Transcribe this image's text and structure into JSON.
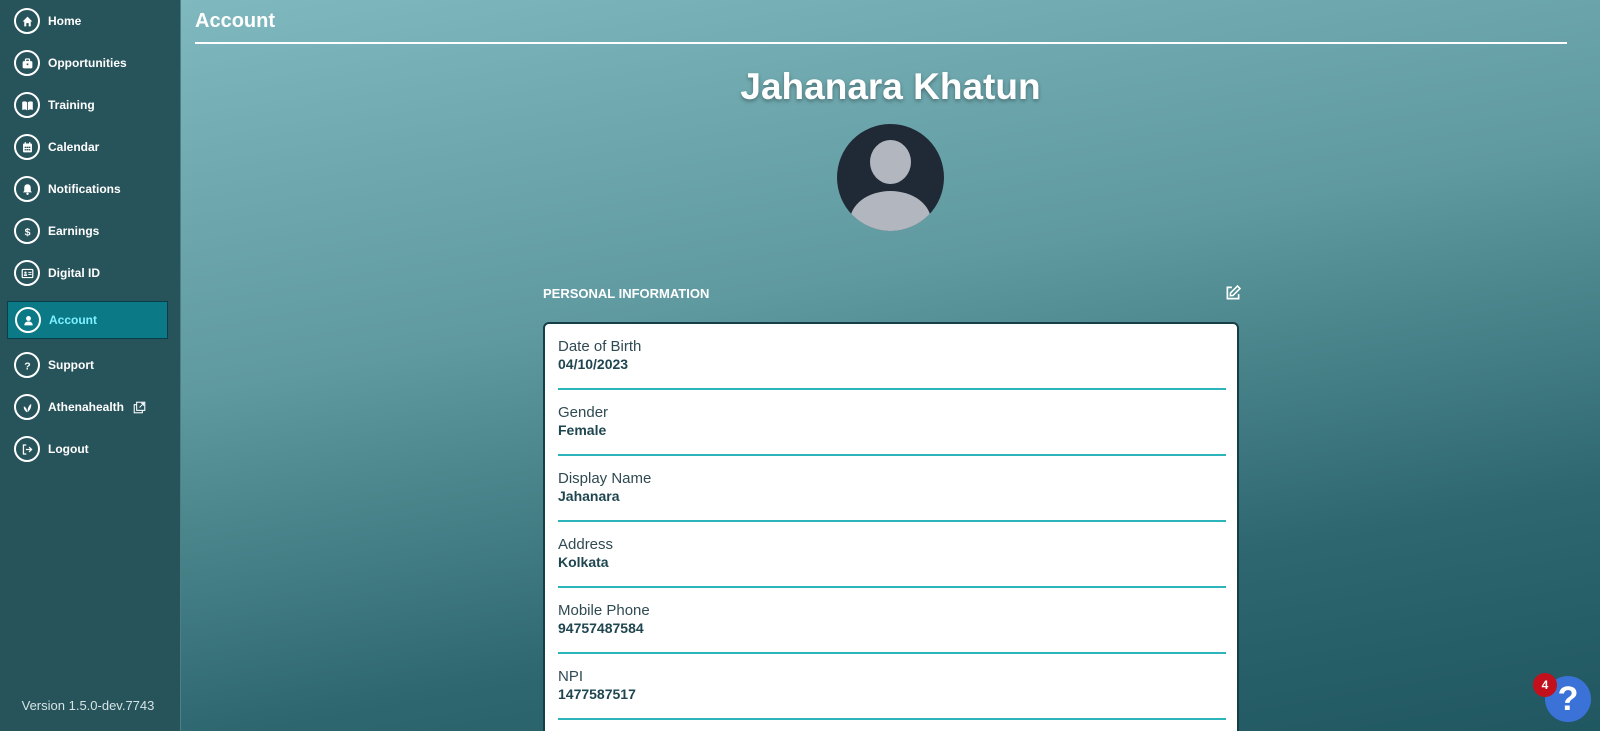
{
  "sidebar": {
    "items": [
      {
        "label": "Home",
        "icon": "home-icon"
      },
      {
        "label": "Opportunities",
        "icon": "briefcase-icon"
      },
      {
        "label": "Training",
        "icon": "book-icon"
      },
      {
        "label": "Calendar",
        "icon": "calendar-icon"
      },
      {
        "label": "Notifications",
        "icon": "bell-icon"
      },
      {
        "label": "Earnings",
        "icon": "dollar-icon"
      },
      {
        "label": "Digital ID",
        "icon": "id-card-icon"
      },
      {
        "label": "Account",
        "icon": "user-icon",
        "active": true
      },
      {
        "label": "Support",
        "icon": "question-icon"
      },
      {
        "label": "Athenahealth",
        "icon": "leaf-icon",
        "external": true
      },
      {
        "label": "Logout",
        "icon": "logout-icon"
      }
    ],
    "version": "Version 1.5.0-dev.7743"
  },
  "header": {
    "title": "Account"
  },
  "profile": {
    "name": "Jahanara Khatun"
  },
  "personal_info": {
    "section_title": "PERSONAL INFORMATION",
    "fields": [
      {
        "label": "Date of Birth",
        "value": "04/10/2023"
      },
      {
        "label": "Gender",
        "value": "Female"
      },
      {
        "label": "Display Name",
        "value": "Jahanara"
      },
      {
        "label": "Address",
        "value": "Kolkata"
      },
      {
        "label": "Mobile Phone",
        "value": "94757487584"
      },
      {
        "label": "NPI",
        "value": "1477587517"
      }
    ]
  },
  "help": {
    "label": "?",
    "badge_count": "4"
  },
  "colors": {
    "sidebar_bg": "#27535a",
    "active_bg": "#0b7a86",
    "active_text": "#7ef0ff",
    "field_divider": "#2bb5bb",
    "help_button": "#3a72d8",
    "badge": "#c2111d"
  }
}
